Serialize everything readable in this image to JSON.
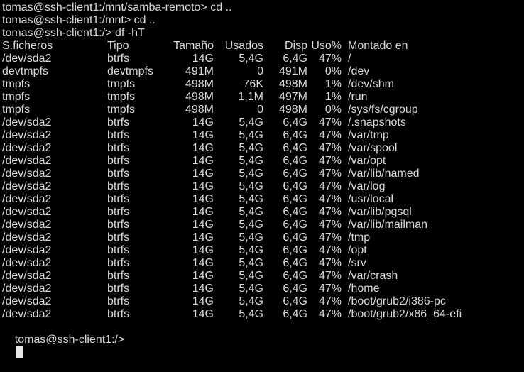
{
  "terminal": {
    "history": [
      "tomas@ssh-client1:/mnt/samba-remoto> cd ..",
      "tomas@ssh-client1:/mnt> cd ..",
      "tomas@ssh-client1:/> df -hT"
    ],
    "table": {
      "headers": {
        "filesystem": "S.ficheros",
        "type": "Tipo",
        "size": "Tamaño",
        "used": "Usados",
        "avail": "Disp",
        "pct": "Uso%",
        "mount": "Montado en"
      },
      "rows": [
        {
          "fs": "/dev/sda2",
          "type": "btrfs",
          "size": "14G",
          "used": "5,4G",
          "avail": "6,4G",
          "pct": "47%",
          "mount": "/"
        },
        {
          "fs": "devtmpfs",
          "type": "devtmpfs",
          "size": "491M",
          "used": "0",
          "avail": "491M",
          "pct": "0%",
          "mount": "/dev"
        },
        {
          "fs": "tmpfs",
          "type": "tmpfs",
          "size": "498M",
          "used": "76K",
          "avail": "498M",
          "pct": "1%",
          "mount": "/dev/shm"
        },
        {
          "fs": "tmpfs",
          "type": "tmpfs",
          "size": "498M",
          "used": "1,1M",
          "avail": "497M",
          "pct": "1%",
          "mount": "/run"
        },
        {
          "fs": "tmpfs",
          "type": "tmpfs",
          "size": "498M",
          "used": "0",
          "avail": "498M",
          "pct": "0%",
          "mount": "/sys/fs/cgroup"
        },
        {
          "fs": "/dev/sda2",
          "type": "btrfs",
          "size": "14G",
          "used": "5,4G",
          "avail": "6,4G",
          "pct": "47%",
          "mount": "/.snapshots"
        },
        {
          "fs": "/dev/sda2",
          "type": "btrfs",
          "size": "14G",
          "used": "5,4G",
          "avail": "6,4G",
          "pct": "47%",
          "mount": "/var/tmp"
        },
        {
          "fs": "/dev/sda2",
          "type": "btrfs",
          "size": "14G",
          "used": "5,4G",
          "avail": "6,4G",
          "pct": "47%",
          "mount": "/var/spool"
        },
        {
          "fs": "/dev/sda2",
          "type": "btrfs",
          "size": "14G",
          "used": "5,4G",
          "avail": "6,4G",
          "pct": "47%",
          "mount": "/var/opt"
        },
        {
          "fs": "/dev/sda2",
          "type": "btrfs",
          "size": "14G",
          "used": "5,4G",
          "avail": "6,4G",
          "pct": "47%",
          "mount": "/var/lib/named"
        },
        {
          "fs": "/dev/sda2",
          "type": "btrfs",
          "size": "14G",
          "used": "5,4G",
          "avail": "6,4G",
          "pct": "47%",
          "mount": "/var/log"
        },
        {
          "fs": "/dev/sda2",
          "type": "btrfs",
          "size": "14G",
          "used": "5,4G",
          "avail": "6,4G",
          "pct": "47%",
          "mount": "/usr/local"
        },
        {
          "fs": "/dev/sda2",
          "type": "btrfs",
          "size": "14G",
          "used": "5,4G",
          "avail": "6,4G",
          "pct": "47%",
          "mount": "/var/lib/pgsql"
        },
        {
          "fs": "/dev/sda2",
          "type": "btrfs",
          "size": "14G",
          "used": "5,4G",
          "avail": "6,4G",
          "pct": "47%",
          "mount": "/var/lib/mailman"
        },
        {
          "fs": "/dev/sda2",
          "type": "btrfs",
          "size": "14G",
          "used": "5,4G",
          "avail": "6,4G",
          "pct": "47%",
          "mount": "/tmp"
        },
        {
          "fs": "/dev/sda2",
          "type": "btrfs",
          "size": "14G",
          "used": "5,4G",
          "avail": "6,4G",
          "pct": "47%",
          "mount": "/opt"
        },
        {
          "fs": "/dev/sda2",
          "type": "btrfs",
          "size": "14G",
          "used": "5,4G",
          "avail": "6,4G",
          "pct": "47%",
          "mount": "/srv"
        },
        {
          "fs": "/dev/sda2",
          "type": "btrfs",
          "size": "14G",
          "used": "5,4G",
          "avail": "6,4G",
          "pct": "47%",
          "mount": "/var/crash"
        },
        {
          "fs": "/dev/sda2",
          "type": "btrfs",
          "size": "14G",
          "used": "5,4G",
          "avail": "6,4G",
          "pct": "47%",
          "mount": "/home"
        },
        {
          "fs": "/dev/sda2",
          "type": "btrfs",
          "size": "14G",
          "used": "5,4G",
          "avail": "6,4G",
          "pct": "47%",
          "mount": "/boot/grub2/i386-pc"
        },
        {
          "fs": "/dev/sda2",
          "type": "btrfs",
          "size": "14G",
          "used": "5,4G",
          "avail": "6,4G",
          "pct": "47%",
          "mount": "/boot/grub2/x86_64-efi"
        }
      ]
    },
    "prompt": "tomas@ssh-client1:/>",
    "input_value": "",
    "colors": {
      "background": "#000000",
      "foreground": "#d9d9d9",
      "cursor": "#e6e6e6"
    }
  }
}
